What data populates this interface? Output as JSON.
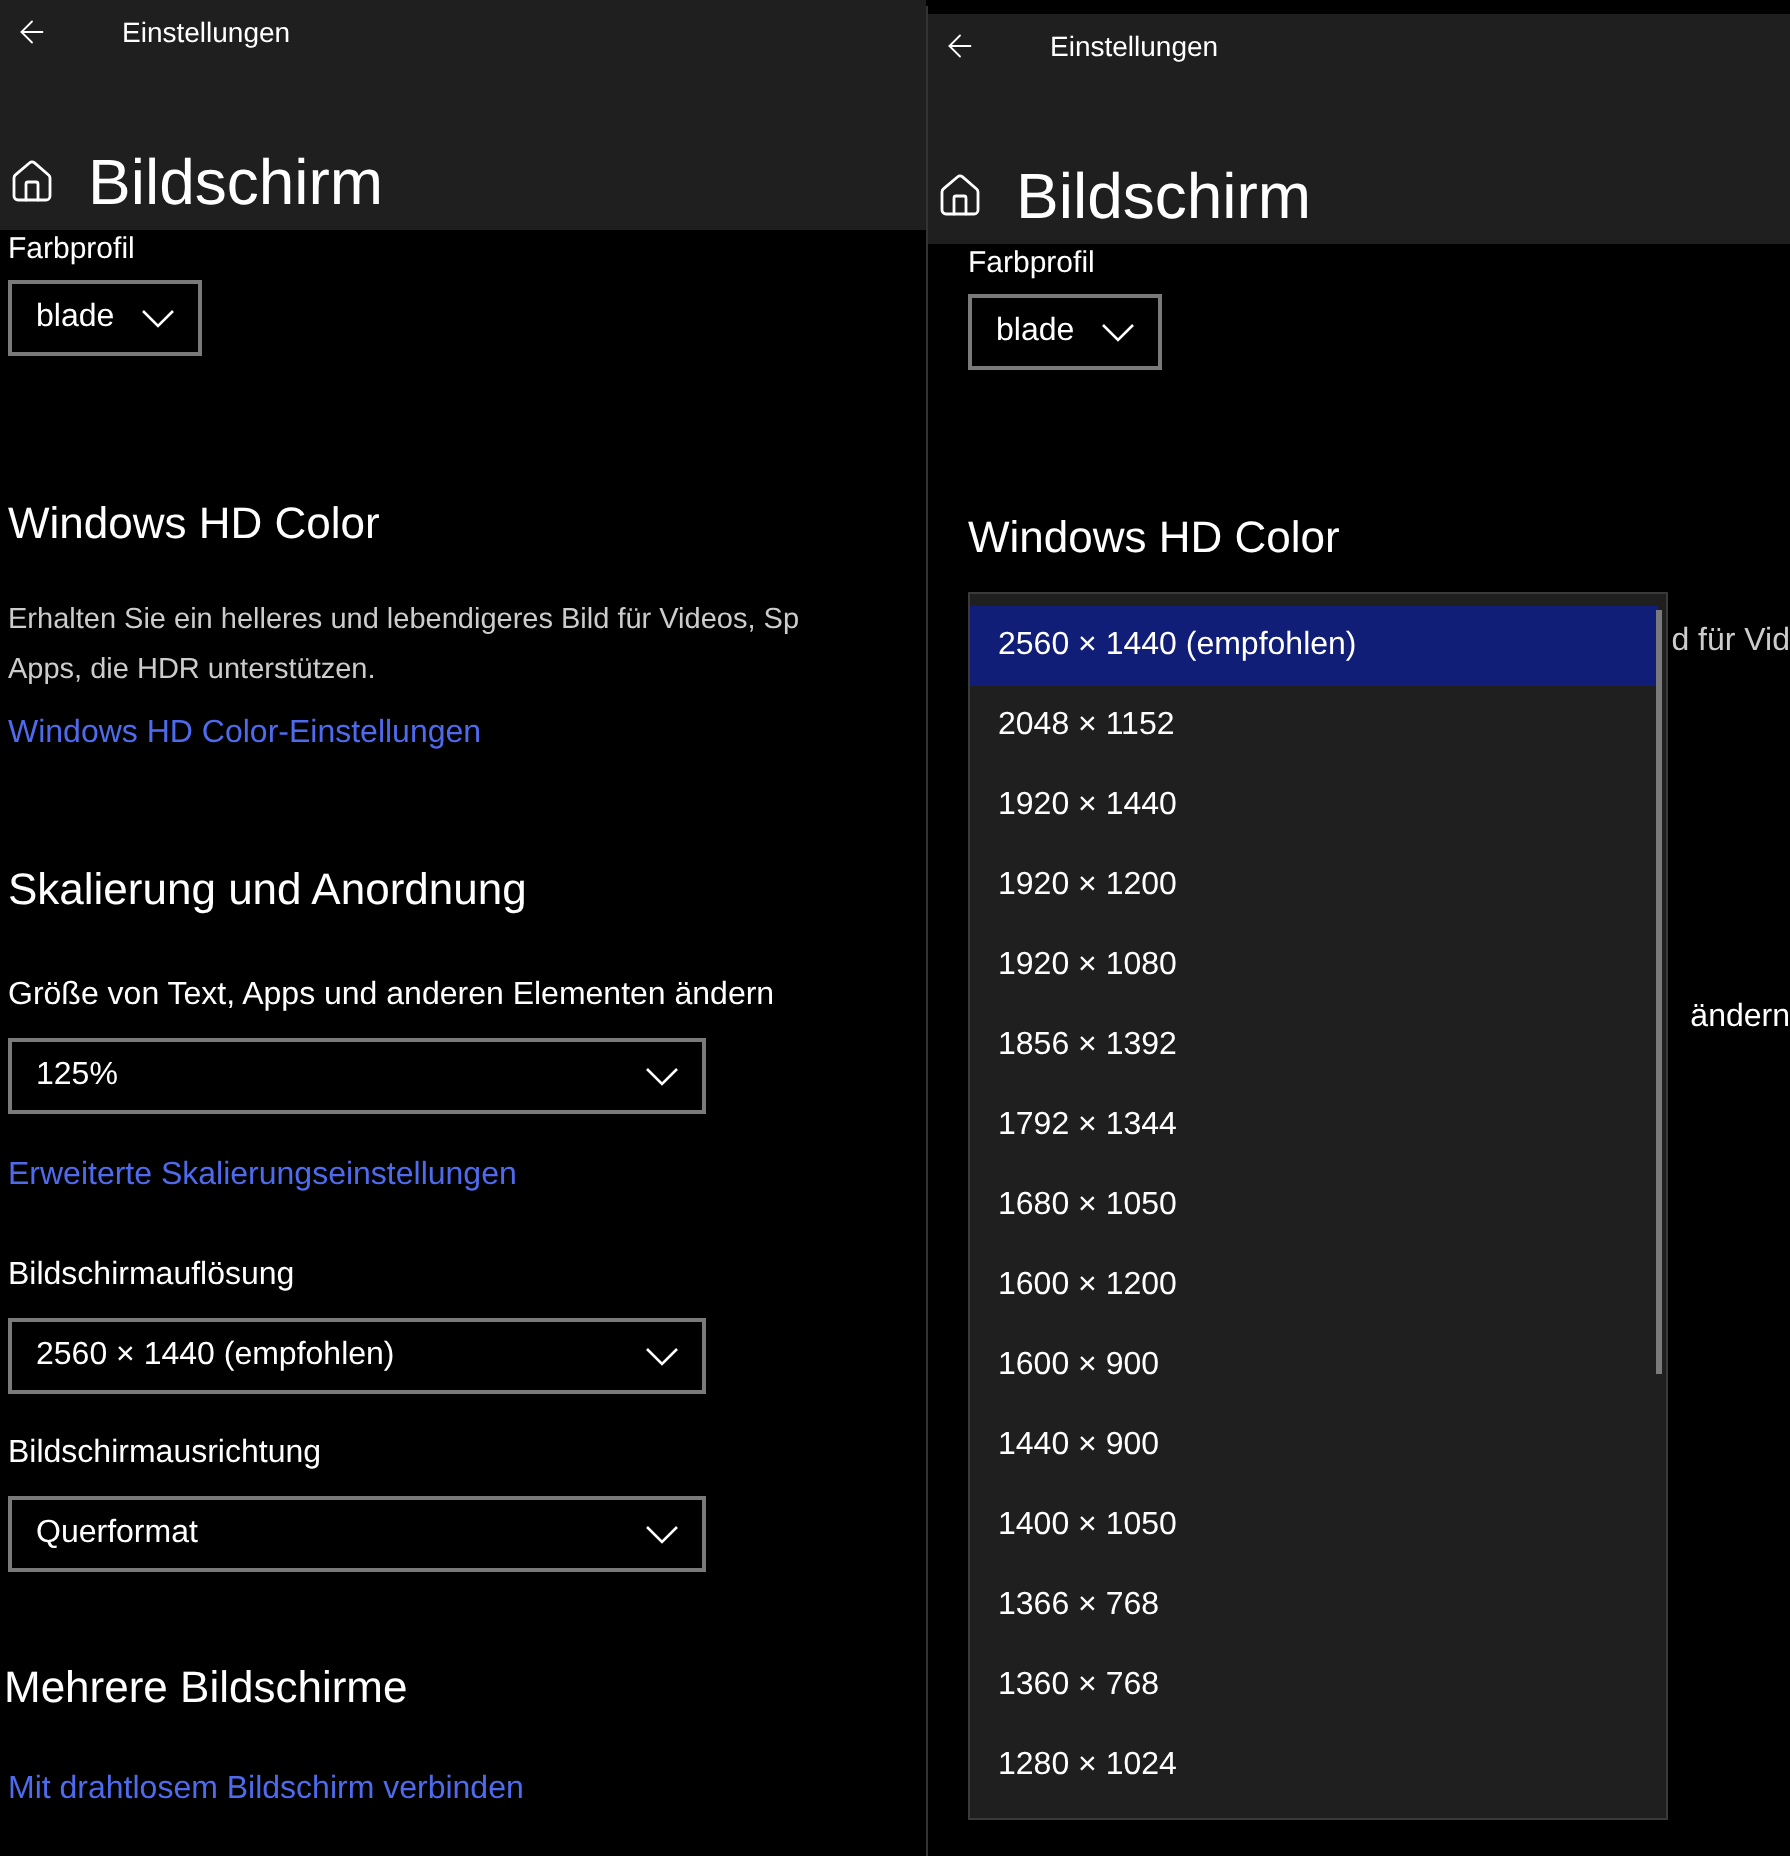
{
  "back_window": {
    "title": "Einstellungen",
    "page_title": "Bildschirm",
    "color_profile": {
      "label": "Farbprofil",
      "value": "blade"
    },
    "hd_color": {
      "heading": "Windows HD Color",
      "description_lines": [
        "Erhalten Sie ein helleres und lebendigeres Bild für Videos, Sp",
        "Apps, die HDR unterstützen."
      ],
      "link": "Windows HD Color-Einstellungen"
    },
    "scaling": {
      "heading": "Skalierung und Anordnung",
      "size_label": "Größe von Text, Apps und anderen Elementen ändern",
      "size_value": "125%",
      "advanced_link": "Erweiterte Skalierungseinstellungen",
      "resolution_label": "Bildschirmauflösung",
      "resolution_value": "2560 × 1440 (empfohlen)",
      "orientation_label": "Bildschirmausrichtung",
      "orientation_value": "Querformat"
    },
    "multiple_displays": {
      "heading": "Mehrere Bildschirme",
      "link": "Mit drahtlosem Bildschirm verbinden"
    }
  },
  "front_window": {
    "title": "Einstellungen",
    "page_title": "Bildschirm",
    "color_profile": {
      "label": "Farbprofil",
      "value": "blade"
    },
    "hd_color_heading": "Windows HD Color",
    "partial_texts": [
      "d für Vid",
      "ändern"
    ],
    "resolution_list": [
      {
        "label": "2560 × 1440 (empfohlen)",
        "selected": true
      },
      {
        "label": "2048 × 1152",
        "selected": false
      },
      {
        "label": "1920 × 1440",
        "selected": false
      },
      {
        "label": "1920 × 1200",
        "selected": false
      },
      {
        "label": "1920 × 1080",
        "selected": false
      },
      {
        "label": "1856 × 1392",
        "selected": false
      },
      {
        "label": "1792 × 1344",
        "selected": false
      },
      {
        "label": "1680 × 1050",
        "selected": false
      },
      {
        "label": "1600 × 1200",
        "selected": false
      },
      {
        "label": "1600 × 900",
        "selected": false
      },
      {
        "label": "1440 × 900",
        "selected": false
      },
      {
        "label": "1400 × 1050",
        "selected": false
      },
      {
        "label": "1366 × 768",
        "selected": false
      },
      {
        "label": "1360 × 768",
        "selected": false
      },
      {
        "label": "1280 × 1024",
        "selected": false
      }
    ]
  }
}
